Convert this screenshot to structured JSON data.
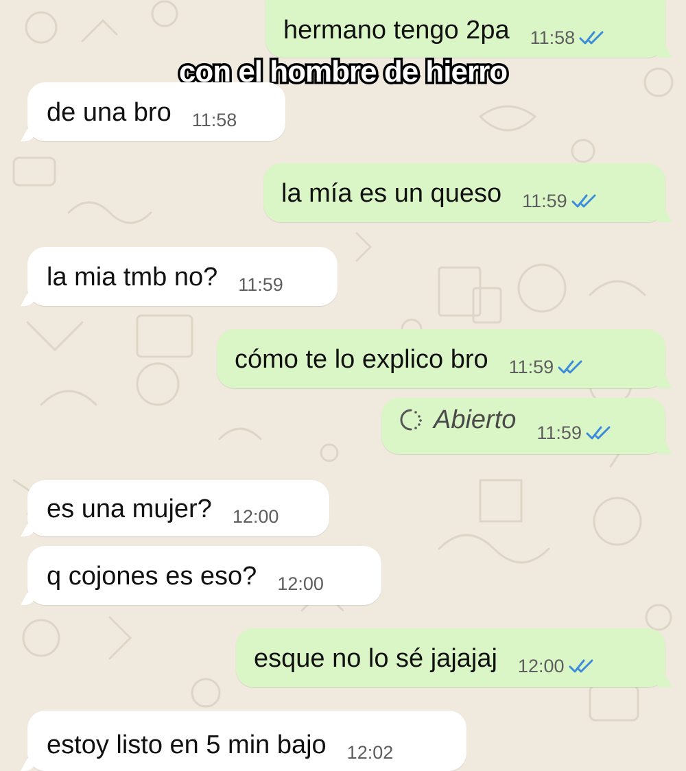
{
  "caption": "con el hombre de hierro",
  "messages": [
    {
      "text": "hermano tengo 2pa",
      "time": "11:58",
      "direction": "outgoing",
      "status": "read"
    },
    {
      "text": "de una bro",
      "time": "11:58",
      "direction": "incoming"
    },
    {
      "text": "la mía es un queso",
      "time": "11:59",
      "direction": "outgoing",
      "status": "read"
    },
    {
      "text": "la mia tmb no?",
      "time": "11:59",
      "direction": "incoming"
    },
    {
      "text": "cómo te lo explico bro",
      "time": "11:59",
      "direction": "outgoing",
      "status": "read"
    },
    {
      "text": "Abierto",
      "time": "11:59",
      "direction": "outgoing",
      "status": "read",
      "icon": "view-once-icon"
    },
    {
      "text": "es una mujer?",
      "time": "12:00",
      "direction": "incoming"
    },
    {
      "text": "q cojones es eso?",
      "time": "12:00",
      "direction": "incoming"
    },
    {
      "text": "esque no lo sé jajajaj",
      "time": "12:00",
      "direction": "outgoing",
      "status": "read"
    },
    {
      "text": "estoy listo en 5 min bajo",
      "time": "12:02",
      "direction": "incoming"
    }
  ],
  "colors": {
    "background": "#efe9de",
    "incoming_bubble": "#ffffff",
    "outgoing_bubble": "#dbf6c6",
    "read_ticks": "#3b8ddb"
  }
}
